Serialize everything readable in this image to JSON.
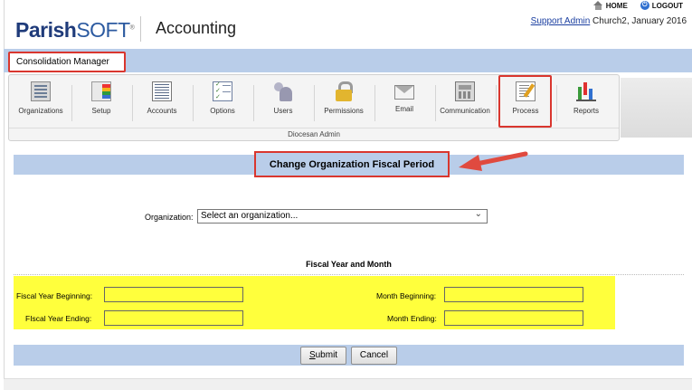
{
  "brand": {
    "logo_bold": "Parish",
    "logo_light": "SOFT",
    "logo_tm": "®"
  },
  "header": {
    "app_title": "Accounting",
    "home_label": "HOME",
    "logout_label": "LOGOUT",
    "user_link": "Support Admin",
    "user_context": " Church2, January 2016"
  },
  "menubar": {
    "consolidation_tab": "Consolidation Manager"
  },
  "toolbar": {
    "items": [
      {
        "label": "Organizations",
        "icon": "organizations-icon"
      },
      {
        "label": "Setup",
        "icon": "setup-icon"
      },
      {
        "label": "Accounts",
        "icon": "accounts-icon"
      },
      {
        "label": "Options",
        "icon": "options-icon"
      },
      {
        "label": "Users",
        "icon": "users-icon"
      },
      {
        "label": "Permissions",
        "icon": "permissions-icon"
      },
      {
        "label": "Email",
        "icon": "email-icon"
      },
      {
        "label": "Communication",
        "icon": "communication-icon"
      },
      {
        "label": "Process",
        "icon": "process-icon"
      },
      {
        "label": "Reports",
        "icon": "reports-icon"
      }
    ],
    "group_label": "Diocesan Admin"
  },
  "page": {
    "title": "Change Organization Fiscal Period",
    "organization_label": "Organization:",
    "organization_value": "Select an organization...",
    "section_title": "Fiscal Year and Month",
    "fiscal_year_beginning_label": "Fiscal Year Beginning:",
    "fiscal_year_ending_label": "FIscal Year Ending:",
    "month_beginning_label": "Month Beginning:",
    "month_ending_label": "Month Ending:",
    "fiscal_year_beginning_value": "",
    "fiscal_year_ending_value": "",
    "month_beginning_value": "",
    "month_ending_value": "",
    "submit_label_first": "S",
    "submit_label_rest": "ubmit",
    "cancel_label": "Cancel"
  },
  "colors": {
    "accent_band": "#b9cde9",
    "highlight": "#d9362e",
    "field_bg": "#ffff3c"
  }
}
